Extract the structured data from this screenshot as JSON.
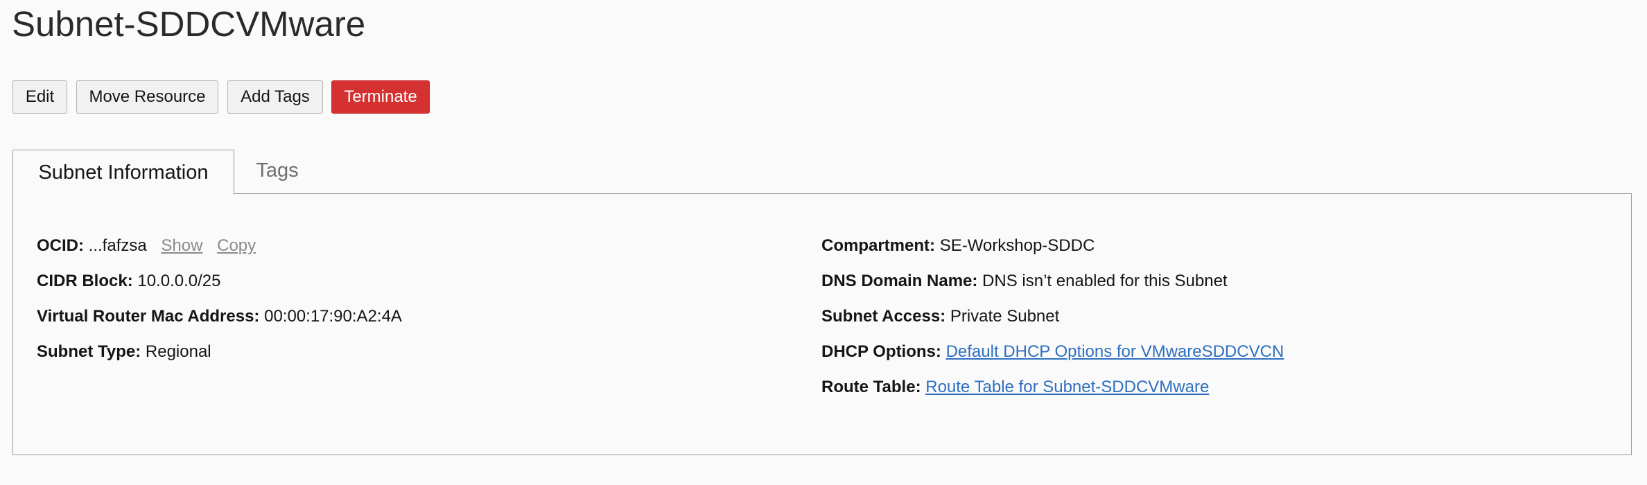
{
  "page": {
    "title": "Subnet-SDDCVMware"
  },
  "toolbar": {
    "edit_label": "Edit",
    "move_label": "Move Resource",
    "add_tags_label": "Add Tags",
    "terminate_label": "Terminate"
  },
  "tabs": [
    {
      "label": "Subnet Information",
      "active": true
    },
    {
      "label": "Tags",
      "active": false
    }
  ],
  "info": {
    "left": [
      {
        "label": "OCID:",
        "value": "...fafzsa",
        "actions": [
          "Show",
          "Copy"
        ]
      },
      {
        "label": "CIDR Block:",
        "value": "10.0.0.0/25"
      },
      {
        "label": "Virtual Router Mac Address:",
        "value": "00:00:17:90:A2:4A"
      },
      {
        "label": "Subnet Type:",
        "value": "Regional"
      }
    ],
    "right": [
      {
        "label": "Compartment:",
        "value": "SE-Workshop-SDDC"
      },
      {
        "label": "DNS Domain Name:",
        "value": "DNS isn’t enabled for this Subnet"
      },
      {
        "label": "Subnet Access:",
        "value": "Private Subnet"
      },
      {
        "label": "DHCP Options:",
        "value": "Default DHCP Options for VMwareSDDCVCN",
        "link": true
      },
      {
        "label": "Route Table:",
        "value": "Route Table for Subnet-SDDCVMware",
        "link": true
      }
    ]
  },
  "colors": {
    "terminate_bg": "#d63131",
    "link": "#2e6fc0",
    "muted_link": "#8a8a8a"
  }
}
